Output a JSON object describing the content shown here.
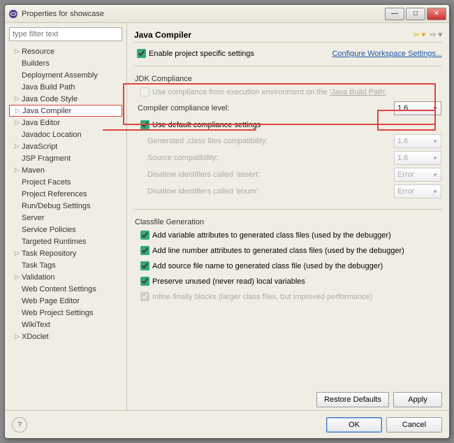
{
  "window": {
    "title": "Properties for showcase"
  },
  "filter_placeholder": "type filter text",
  "tree": [
    {
      "label": "Resource",
      "exp": true,
      "lvl": 1
    },
    {
      "label": "Builders",
      "exp": false,
      "lvl": 1
    },
    {
      "label": "Deployment Assembly",
      "exp": false,
      "lvl": 1
    },
    {
      "label": "Java Build Path",
      "exp": false,
      "lvl": 1
    },
    {
      "label": "Java Code Style",
      "exp": true,
      "lvl": 1
    },
    {
      "label": "Java Compiler",
      "exp": true,
      "lvl": 1,
      "selected": true
    },
    {
      "label": "Java Editor",
      "exp": true,
      "lvl": 1
    },
    {
      "label": "Javadoc Location",
      "exp": false,
      "lvl": 1
    },
    {
      "label": "JavaScript",
      "exp": true,
      "lvl": 1
    },
    {
      "label": "JSP Fragment",
      "exp": false,
      "lvl": 1
    },
    {
      "label": "Maven",
      "exp": true,
      "lvl": 1
    },
    {
      "label": "Project Facets",
      "exp": false,
      "lvl": 1
    },
    {
      "label": "Project References",
      "exp": false,
      "lvl": 1
    },
    {
      "label": "Run/Debug Settings",
      "exp": false,
      "lvl": 1
    },
    {
      "label": "Server",
      "exp": false,
      "lvl": 1
    },
    {
      "label": "Service Policies",
      "exp": false,
      "lvl": 1
    },
    {
      "label": "Targeted Runtimes",
      "exp": false,
      "lvl": 1
    },
    {
      "label": "Task Repository",
      "exp": true,
      "lvl": 1
    },
    {
      "label": "Task Tags",
      "exp": false,
      "lvl": 1
    },
    {
      "label": "Validation",
      "exp": true,
      "lvl": 1
    },
    {
      "label": "Web Content Settings",
      "exp": false,
      "lvl": 1
    },
    {
      "label": "Web Page Editor",
      "exp": false,
      "lvl": 1
    },
    {
      "label": "Web Project Settings",
      "exp": false,
      "lvl": 1
    },
    {
      "label": "WikiText",
      "exp": false,
      "lvl": 1
    },
    {
      "label": "XDoclet",
      "exp": true,
      "lvl": 1
    }
  ],
  "main": {
    "title": "Java Compiler",
    "enable_specific": "Enable project specific settings",
    "configure_link": "Configure Workspace Settings...",
    "jdk_section": "JDK Compliance",
    "use_exec_env_pre": "Use compliance from execution environment on the ",
    "use_exec_env_link": "'Java Build Path'",
    "compliance_level_label": "Compiler compliance level:",
    "compliance_level_value": "1.6",
    "use_default": "Use default compliance settings",
    "rows": [
      {
        "label": "Generated .class files compatibility:",
        "value": "1.6"
      },
      {
        "label": "Source compatibility:",
        "value": "1.6"
      },
      {
        "label": "Disallow identifiers called 'assert':",
        "value": "Error"
      },
      {
        "label": "Disallow identifiers called 'enum':",
        "value": "Error"
      }
    ],
    "classfile_section": "Classfile Generation",
    "cf_checks": [
      {
        "label": "Add variable attributes to generated class files (used by the debugger)",
        "checked": true,
        "dis": false
      },
      {
        "label": "Add line number attributes to generated class files (used by the debugger)",
        "checked": true,
        "dis": false
      },
      {
        "label": "Add source file name to generated class file (used by the debugger)",
        "checked": true,
        "dis": false
      },
      {
        "label": "Preserve unused (never read) local variables",
        "checked": true,
        "dis": false
      },
      {
        "label": "Inline finally blocks (larger class files, but improved performance)",
        "checked": true,
        "dis": true
      }
    ],
    "restore": "Restore Defaults",
    "apply": "Apply"
  },
  "bottom": {
    "ok": "OK",
    "cancel": "Cancel"
  }
}
